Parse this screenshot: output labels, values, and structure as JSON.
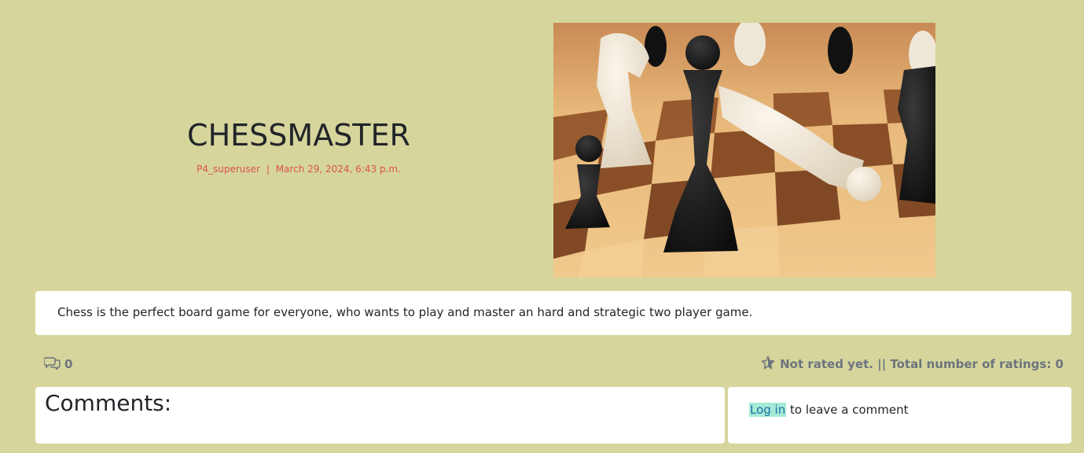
{
  "post": {
    "title": "CHESSMASTER",
    "author": "P4_superuser",
    "separator": "|",
    "date": "March 29, 2024, 6:43 p.m.",
    "content": "Chess is the perfect board game for everyone, who wants to play and master an hard and strategic two player game."
  },
  "stats": {
    "comment_count": "0",
    "rating_text": "Not rated yet. || Total number of ratings: 0"
  },
  "comments": {
    "heading": "Comments:",
    "login_link": "Log in",
    "login_suffix": " to leave a comment"
  },
  "colors": {
    "background": "#d6d59c",
    "meta": "#d9534f",
    "link_highlight": "#a6e9d5"
  },
  "icons": {
    "comments": "comments-icon",
    "rating": "star-icon"
  }
}
